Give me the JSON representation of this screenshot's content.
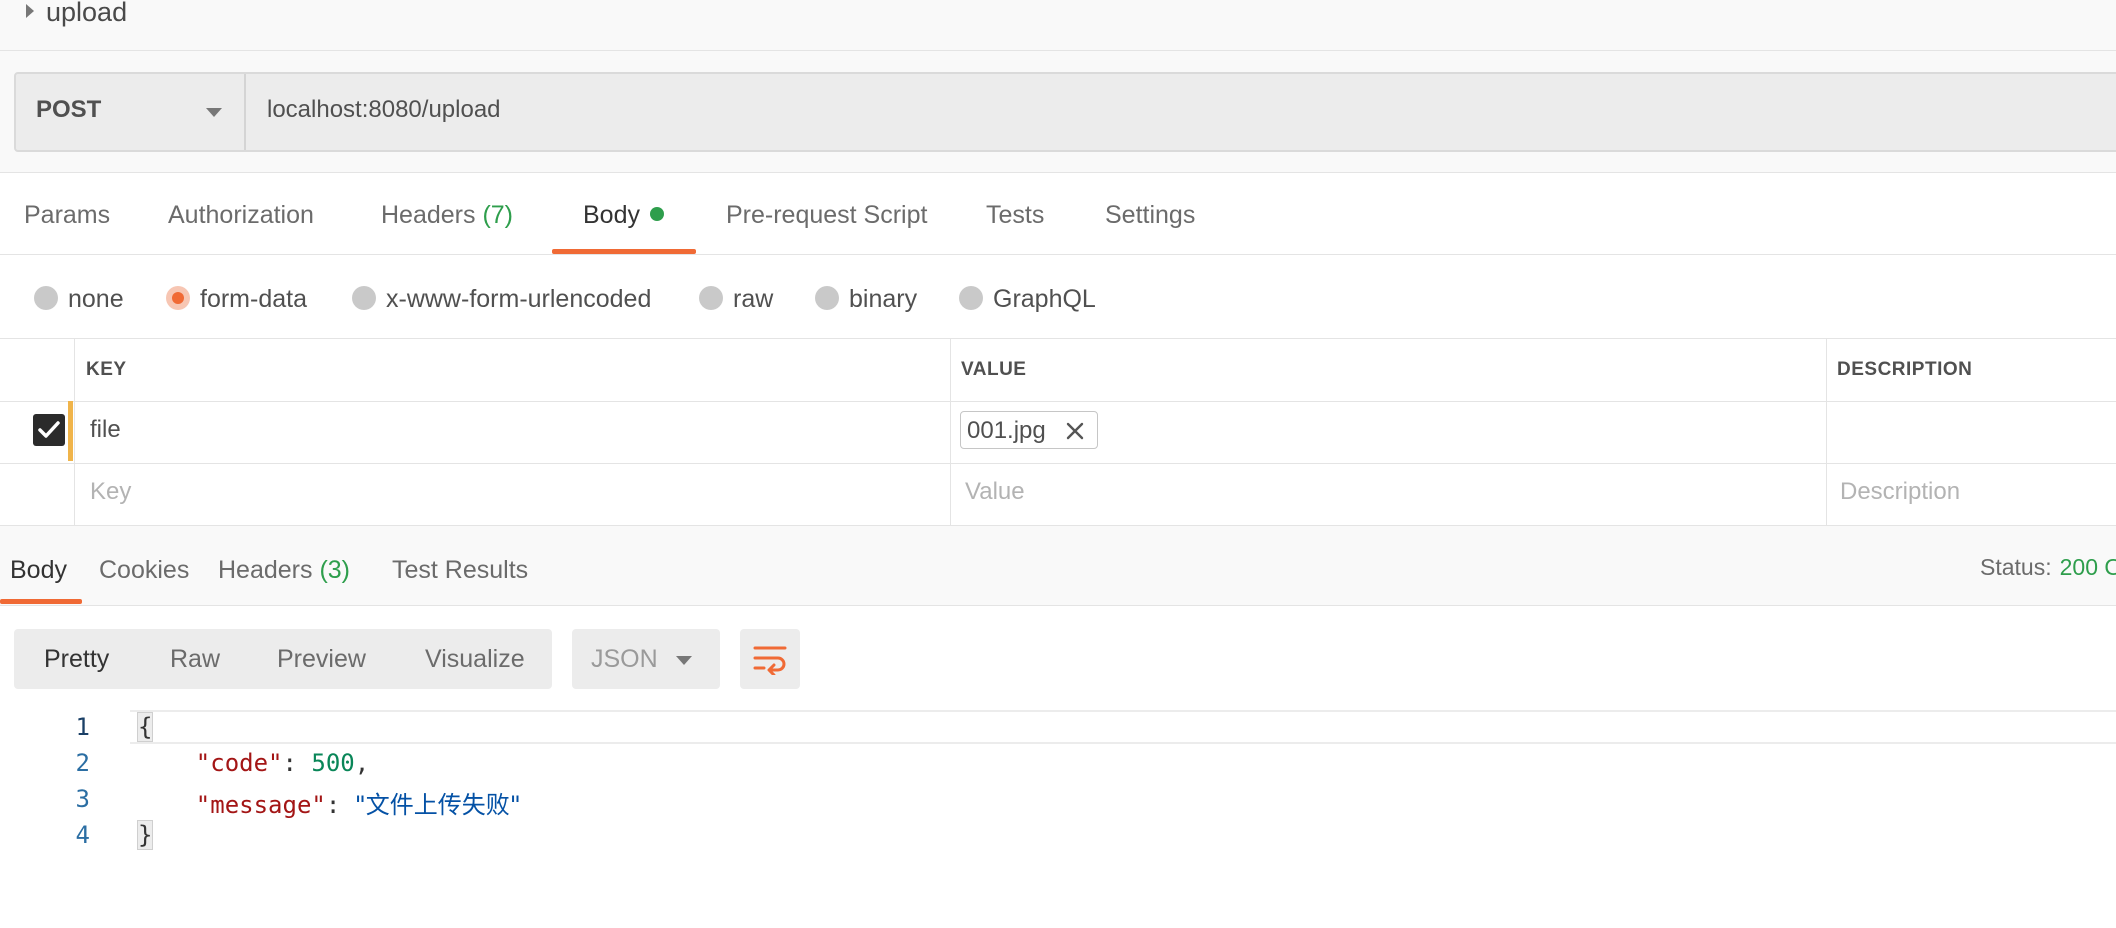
{
  "request": {
    "name": "upload",
    "method": "POST",
    "url": "localhost:8080/upload"
  },
  "request_tabs": [
    {
      "label": "Params"
    },
    {
      "label": "Authorization"
    },
    {
      "label": "Headers",
      "count": "(7)"
    },
    {
      "label": "Body"
    },
    {
      "label": "Pre-request Script"
    },
    {
      "label": "Tests"
    },
    {
      "label": "Settings"
    }
  ],
  "body_types": [
    {
      "label": "none",
      "selected": false
    },
    {
      "label": "form-data",
      "selected": true
    },
    {
      "label": "x-www-form-urlencoded",
      "selected": false
    },
    {
      "label": "raw",
      "selected": false
    },
    {
      "label": "binary",
      "selected": false
    },
    {
      "label": "GraphQL",
      "selected": false
    }
  ],
  "params_table": {
    "headers": {
      "key": "KEY",
      "value": "VALUE",
      "description": "DESCRIPTION"
    },
    "rows": [
      {
        "checked": true,
        "key": "file",
        "value_file": "001.jpg",
        "description": ""
      }
    ],
    "placeholders": {
      "key": "Key",
      "value": "Value",
      "description": "Description"
    }
  },
  "response_tabs": [
    {
      "label": "Body"
    },
    {
      "label": "Cookies"
    },
    {
      "label": "Headers",
      "count": "(3)"
    },
    {
      "label": "Test Results"
    }
  ],
  "status": {
    "label": "Status:",
    "value": "200 O"
  },
  "view_modes": [
    "Pretty",
    "Raw",
    "Preview",
    "Visualize"
  ],
  "active_view_mode": "Pretty",
  "format": "JSON",
  "response_code": {
    "line_numbers": [
      "1",
      "2",
      "3",
      "4"
    ],
    "open_brace": "{",
    "close_brace": "}",
    "code_key": "\"code\"",
    "code_value": "500",
    "message_key": "\"message\"",
    "message_value": "\"文件上传失败\""
  },
  "colors": {
    "accent": "#f06a35",
    "success": "#2e9e4c",
    "modified_marker": "#f0b44a"
  },
  "icons": {
    "collapse": "caret-right-icon",
    "method_dropdown": "chevron-down-icon",
    "remove_file": "close-icon",
    "wrap_lines": "wrap-lines-icon",
    "checkbox": "check-icon"
  }
}
